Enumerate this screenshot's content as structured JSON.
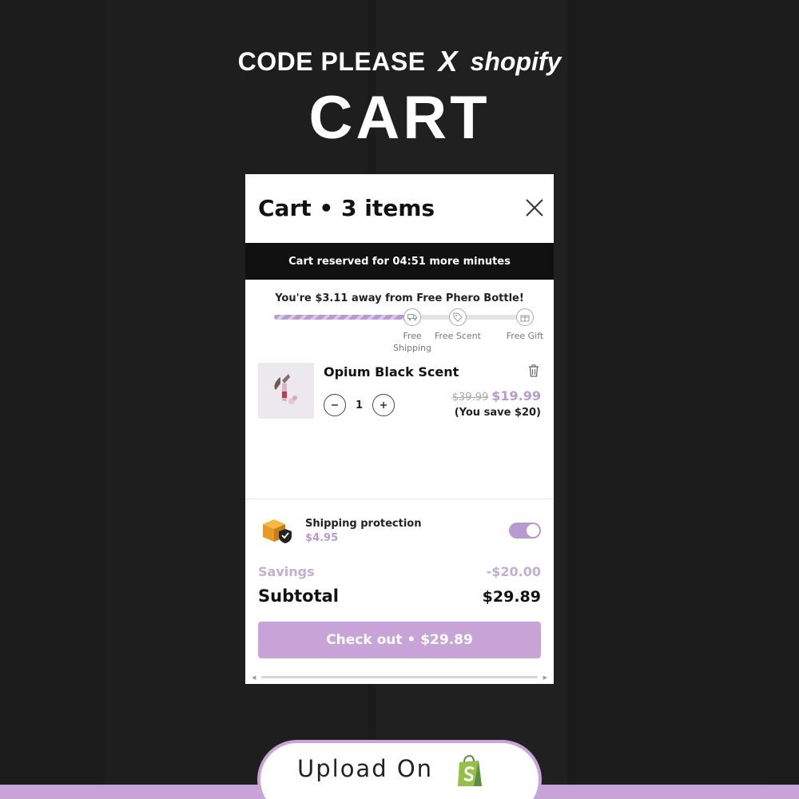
{
  "header": {
    "brand_left": "CODE PLEASE",
    "brand_x": "X",
    "brand_right": "shopify",
    "title": "CART"
  },
  "cart": {
    "title": "Cart • 3 items",
    "reserve_text": "Cart reserved for 04:51 more minutes",
    "progress": {
      "message": "You're $3.11 away from Free Phero Bottle!",
      "fill_fraction": 0.55,
      "milestones": [
        {
          "label_line1": "Free",
          "label_line2": "Shipping",
          "icon": "truck-icon"
        },
        {
          "label_line1": "Free Scent",
          "label_line2": "",
          "icon": "tag-icon"
        },
        {
          "label_line1": "Free Gift",
          "label_line2": "",
          "icon": "gift-icon"
        }
      ]
    },
    "item": {
      "name": "Opium Black Scent",
      "quantity": "1",
      "price_old": "$39.99",
      "price_new": "$19.99",
      "savings_note": "(You save $20)"
    },
    "shipping_protection": {
      "title": "Shipping protection",
      "price": "$4.95",
      "enabled": true
    },
    "summary": {
      "savings_label": "Savings",
      "savings_value": "-$20.00",
      "subtotal_label": "Subtotal",
      "subtotal_value": "$29.89"
    },
    "checkout_label": "Check out • $29.89"
  },
  "footer": {
    "upload_text": "Upload On"
  },
  "colors": {
    "accent": "#c7a3d8",
    "background": "#1b1b1b",
    "dark_bar": "#111111"
  }
}
